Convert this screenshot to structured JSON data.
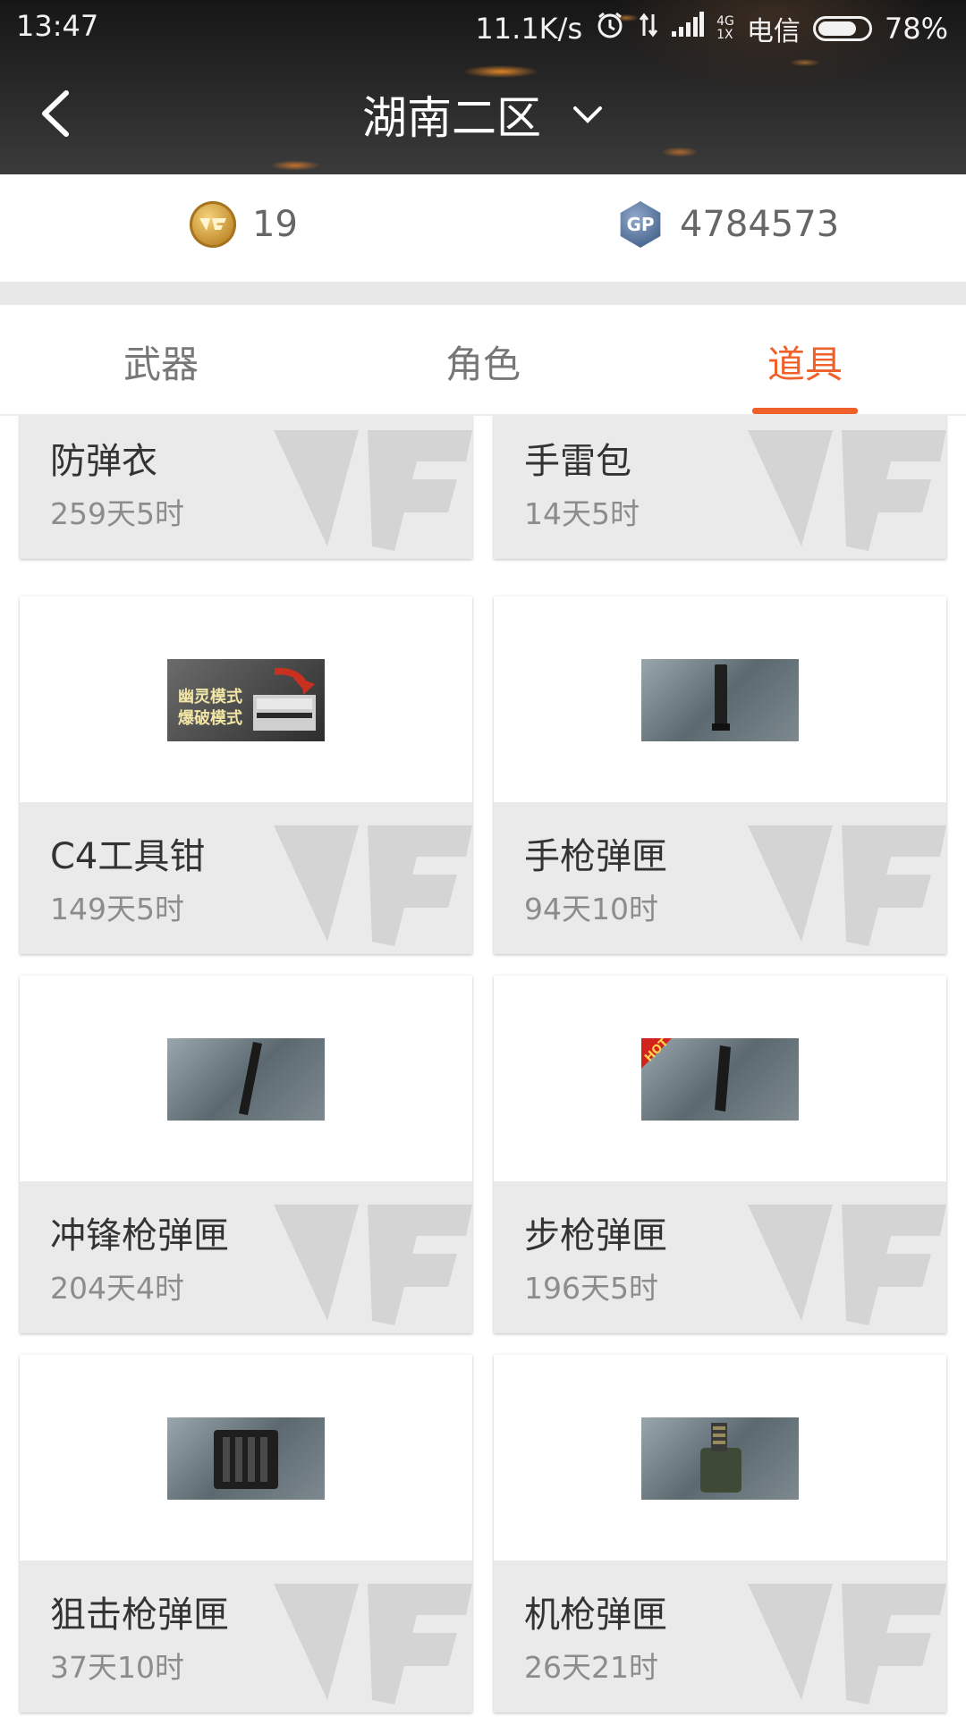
{
  "status_bar": {
    "time": "13:47",
    "speed": "11.1K/s",
    "network_small": "4G",
    "network_sub": "1X",
    "carrier": "电信",
    "battery_text": "78%",
    "battery_level": 0.78
  },
  "header": {
    "title": "湖南二区"
  },
  "currency": {
    "cf_coin_value": "19",
    "gp_value": "4784573",
    "gp_icon_text": "GP"
  },
  "tabs": [
    {
      "label": "武器",
      "active": false
    },
    {
      "label": "角色",
      "active": false
    },
    {
      "label": "道具",
      "active": true
    }
  ],
  "items": [
    {
      "name": "防弹衣",
      "time": "259天5时",
      "thumb": "none"
    },
    {
      "name": "手雷包",
      "time": "14天5时",
      "thumb": "none"
    },
    {
      "name": "C4工具钳",
      "time": "149天5时",
      "thumb": "c4-pliers",
      "thumb_text_1": "幽灵模式",
      "thumb_text_2": "爆破模式"
    },
    {
      "name": "手枪弹匣",
      "time": "94天10时",
      "thumb": "pistol-mag"
    },
    {
      "name": "冲锋枪弹匣",
      "time": "204天4时",
      "thumb": "smg-mag"
    },
    {
      "name": "步枪弹匣",
      "time": "196天5时",
      "thumb": "rifle-mag",
      "thumb_badge": "HOT"
    },
    {
      "name": "狙击枪弹匣",
      "time": "37天10时",
      "thumb": "sniper-mag"
    },
    {
      "name": "机枪弹匣",
      "time": "26天21时",
      "thumb": "mg-mag"
    }
  ],
  "colors": {
    "accent": "#f0602b",
    "card_info_bg": "#eaeaea",
    "separator": "#e8e8e8"
  }
}
